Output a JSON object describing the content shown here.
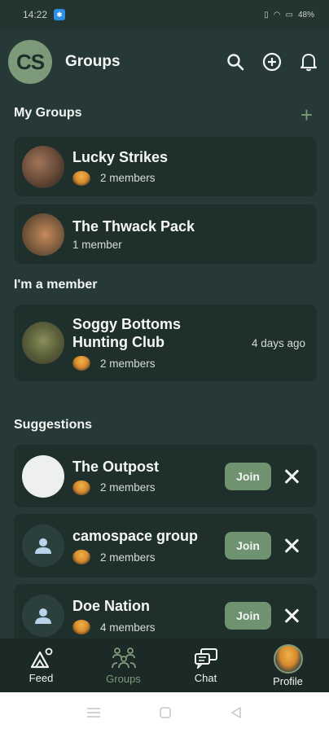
{
  "status": {
    "time": "14:22",
    "battery": "48%"
  },
  "header": {
    "logo_text": "CS",
    "title": "Groups"
  },
  "sections": {
    "my_groups": "My Groups",
    "member": "I'm a member",
    "suggestions": "Suggestions"
  },
  "my_groups": [
    {
      "name": "Lucky Strikes",
      "members": "2 members"
    },
    {
      "name": "The Thwack Pack",
      "members": "1 member"
    }
  ],
  "member_groups": [
    {
      "name": "Soggy Bottoms Hunting Club",
      "members": "2 members",
      "time": "4 days ago"
    }
  ],
  "suggestions": [
    {
      "name": "The Outpost",
      "members": "2 members",
      "join": "Join"
    },
    {
      "name": "camospace group",
      "members": "2 members",
      "join": "Join"
    },
    {
      "name": "Doe Nation",
      "members": "4 members",
      "join": "Join"
    }
  ],
  "nav": {
    "feed": "Feed",
    "groups": "Groups",
    "chat": "Chat",
    "profile": "Profile"
  },
  "colors": {
    "background": "#263936",
    "card": "#1e2f2c",
    "accent": "#7c9a7a",
    "join": "#6f9270"
  }
}
